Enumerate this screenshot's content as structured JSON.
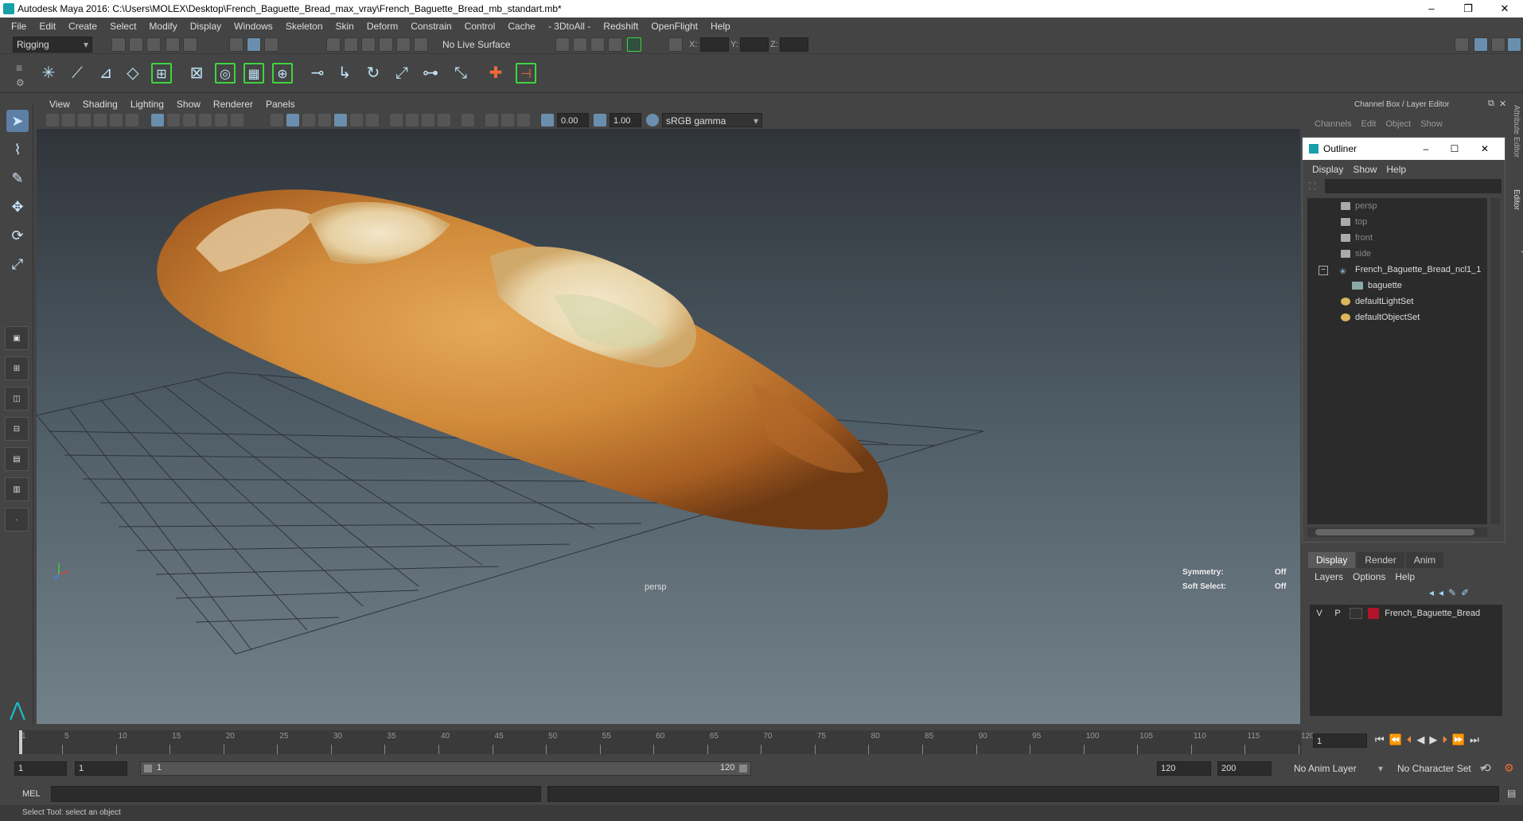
{
  "window": {
    "title": "Autodesk Maya 2016: C:\\Users\\MOLEX\\Desktop\\French_Baguette_Bread_max_vray\\French_Baguette_Bread_mb_standart.mb*",
    "controls": [
      "–",
      "❐",
      "✕"
    ]
  },
  "menubar": [
    "File",
    "Edit",
    "Create",
    "Select",
    "Modify",
    "Display",
    "Windows",
    "Skeleton",
    "Skin",
    "Deform",
    "Constrain",
    "Control",
    "Cache",
    "- 3DtoAll -",
    "Redshift",
    "OpenFlight",
    "Help"
  ],
  "statusline": {
    "menu_set": "Rigging",
    "live_surface": "No Live Surface",
    "x_label": "X:",
    "y_label": "Y:",
    "z_label": "Z:"
  },
  "viewport": {
    "menu": [
      "View",
      "Shading",
      "Lighting",
      "Show",
      "Renderer",
      "Panels"
    ],
    "exposure": "0.00",
    "gamma": "1.00",
    "color_space": "sRGB gamma",
    "camera_label": "persp",
    "symmetry_label": "Symmetry:",
    "symmetry_value": "Off",
    "soft_select_label": "Soft Select:",
    "soft_select_value": "Off"
  },
  "channelbox": {
    "title": "Channel Box / Layer Editor",
    "menu": [
      "Channels",
      "Edit",
      "Object",
      "Show"
    ]
  },
  "side_tabs": [
    "Attribute Editor",
    "Channel Box / Layer Editor"
  ],
  "outliner": {
    "title": "Outliner",
    "menu": [
      "Display",
      "Show",
      "Help"
    ],
    "items": [
      {
        "label": "persp",
        "dim": true
      },
      {
        "label": "top",
        "dim": true
      },
      {
        "label": "front",
        "dim": true
      },
      {
        "label": "side",
        "dim": true
      },
      {
        "label": "French_Baguette_Bread_ncl1_1",
        "dim": false
      },
      {
        "label": "baguette",
        "dim": false
      },
      {
        "label": "defaultLightSet",
        "dim": false
      },
      {
        "label": "defaultObjectSet",
        "dim": false
      }
    ]
  },
  "layers": {
    "tabs": [
      "Display",
      "Render",
      "Anim"
    ],
    "menu": [
      "Layers",
      "Options",
      "Help"
    ],
    "row": {
      "v": "V",
      "p": "P",
      "name": "French_Baguette_Bread",
      "color": "#b0142a"
    }
  },
  "timeslider": {
    "ticks": [
      1,
      5,
      10,
      15,
      20,
      25,
      30,
      35,
      40,
      45,
      50,
      55,
      60,
      65,
      70,
      75,
      80,
      85,
      90,
      95,
      100,
      105,
      110,
      115,
      120
    ],
    "current_frame": "1"
  },
  "rangeslider": {
    "start": "1",
    "playback_start": "1",
    "range_start": "1",
    "range_end": "120",
    "playback_end": "120",
    "end": "200",
    "anim_layer": "No Anim Layer",
    "character_set": "No Character Set"
  },
  "cmdline": {
    "label": "MEL"
  },
  "helpline": {
    "text": "Select Tool: select an object"
  }
}
